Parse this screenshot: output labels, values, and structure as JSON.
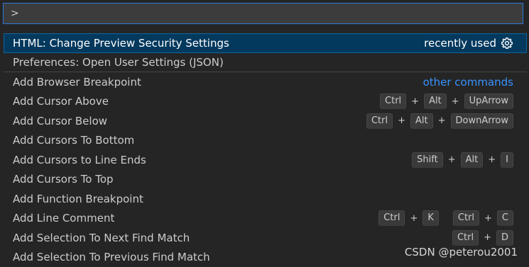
{
  "command_palette": {
    "input_value": ">",
    "items": [
      {
        "label": "HTML: Change Preview Security Settings",
        "hint": "recently used"
      },
      {
        "label": "Preferences: Open User Settings (JSON)"
      },
      {
        "label": "Add Browser Breakpoint",
        "hint": "other commands"
      },
      {
        "label": "Add Cursor Above",
        "keys": [
          "Ctrl",
          "Alt",
          "UpArrow"
        ]
      },
      {
        "label": "Add Cursor Below",
        "keys": [
          "Ctrl",
          "Alt",
          "DownArrow"
        ]
      },
      {
        "label": "Add Cursors To Bottom"
      },
      {
        "label": "Add Cursors to Line Ends",
        "keys": [
          "Shift",
          "Alt",
          "I"
        ]
      },
      {
        "label": "Add Cursors To Top"
      },
      {
        "label": "Add Function Breakpoint"
      },
      {
        "label": "Add Line Comment",
        "chord1": [
          "Ctrl",
          "K"
        ],
        "chord2": [
          "Ctrl",
          "C"
        ]
      },
      {
        "label": "Add Selection To Next Find Match",
        "keys": [
          "Ctrl",
          "D"
        ]
      },
      {
        "label": "Add Selection To Previous Find Match"
      }
    ]
  },
  "watermark": "CSDN @peterou2001",
  "colors": {
    "background": "#252526",
    "input_border": "#2c7ad6",
    "selected_bg": "#04395e",
    "link_blue": "#3794ff"
  },
  "icons": {
    "configure": "gear-icon"
  }
}
